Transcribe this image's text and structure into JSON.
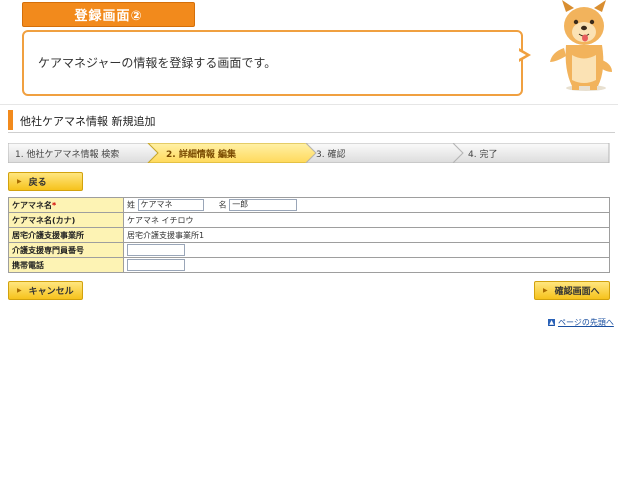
{
  "header": {
    "tab_label": "登録画面②"
  },
  "bubble": {
    "text": "ケアマネジャーの情報を登録する画面です。"
  },
  "page": {
    "title": "他社ケアマネ情報  新規追加"
  },
  "steps": [
    {
      "label": "1. 他社ケアマネ情報 検索",
      "active": false
    },
    {
      "label": "2. 詳細情報 編集",
      "active": true
    },
    {
      "label": "3. 確認",
      "active": false
    },
    {
      "label": "4. 完了",
      "active": false
    }
  ],
  "buttons": {
    "back": "戻る",
    "cancel": "キャンセル",
    "confirm": "確認画面へ"
  },
  "form": {
    "name_label": "ケアマネ名",
    "required_mark": "*",
    "last_name_prefix": "姓",
    "last_name_value": "ケアマネ",
    "first_name_prefix": "名",
    "first_name_value": "一郎",
    "kana_label": "ケアマネ名(カナ)",
    "kana_value": "ケアマネ イチロウ",
    "office_label": "居宅介護支援事業所",
    "office_value": "居宅介護支援事業所1",
    "cm_number_label": "介護支援専門員番号",
    "cm_number_value": "",
    "mobile_label": "携帯電話",
    "mobile_value": ""
  },
  "footer": {
    "page_top_link": "ページの先頭へ"
  },
  "colors": {
    "accent": "#f28a1c",
    "button": "#f6c21c",
    "label_bg": "#fdf3b4",
    "active_step": "#ffe27a"
  },
  "icons": {
    "button_arrow": "triangle-right-icon",
    "page_top": "arrow-up-icon",
    "mascot": "dog-mascot"
  }
}
